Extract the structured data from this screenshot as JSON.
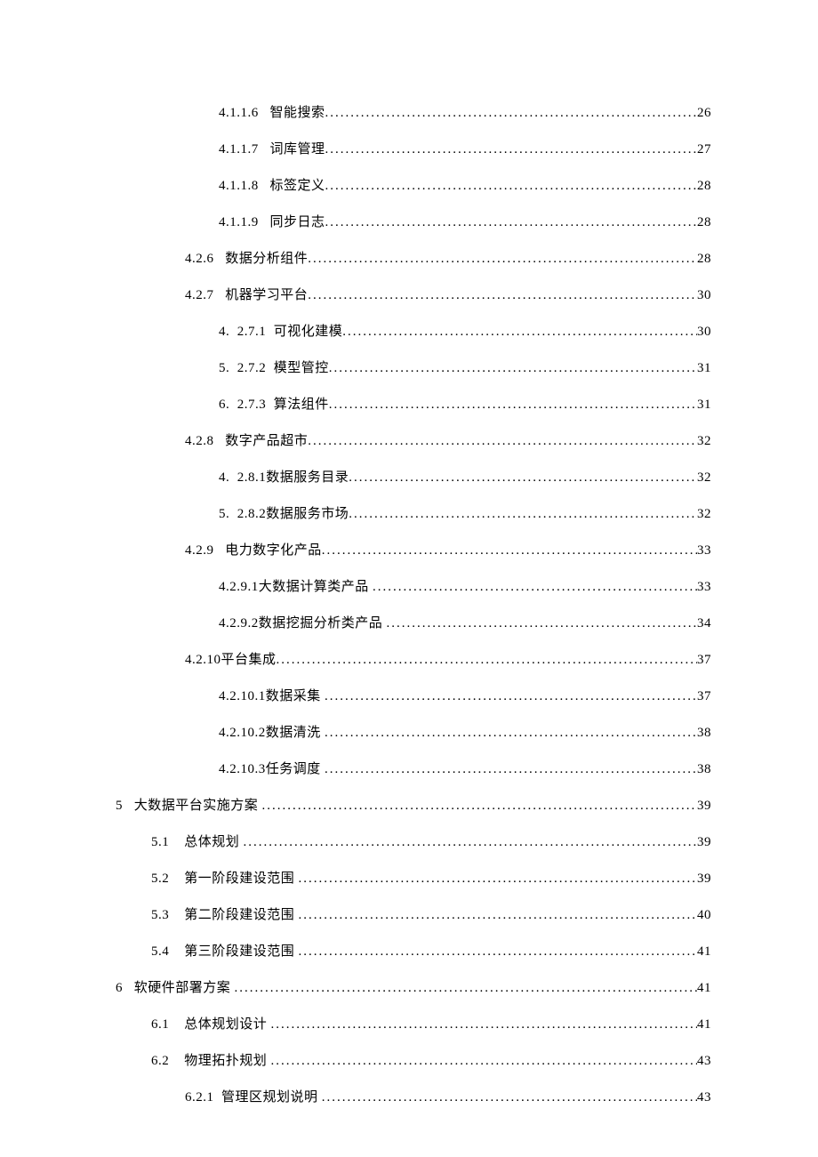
{
  "dotfill": "................................................................................................................................",
  "toc": [
    {
      "indent": "indent-l4",
      "num": "4.1.1.6",
      "gap": "   ",
      "title": "智能搜索",
      "page": "26"
    },
    {
      "indent": "indent-l4",
      "num": "4.1.1.7",
      "gap": "   ",
      "title": "词库管理",
      "page": "27"
    },
    {
      "indent": "indent-l4",
      "num": "4.1.1.8",
      "gap": "   ",
      "title": "标签定义",
      "page": "28"
    },
    {
      "indent": "indent-l4",
      "num": "4.1.1.9",
      "gap": "   ",
      "title": "同步日志",
      "page": "28"
    },
    {
      "indent": "indent-l3",
      "num": "4.2.6",
      "gap": "   ",
      "title": "数据分析组件",
      "page": "28"
    },
    {
      "indent": "indent-l3",
      "num": "4.2.7",
      "gap": "   ",
      "title": "机器学习平台",
      "page": "30"
    },
    {
      "indent": "indent-l4",
      "num": "4.",
      "gap": "  ",
      "title": "2.7.1  可视化建模",
      "page": "30"
    },
    {
      "indent": "indent-l4",
      "num": "5.",
      "gap": "  ",
      "title": "2.7.2  模型管控",
      "page": "31"
    },
    {
      "indent": "indent-l4",
      "num": "6.",
      "gap": "  ",
      "title": "2.7.3  算法组件",
      "page": "31"
    },
    {
      "indent": "indent-l3",
      "num": "4.2.8",
      "gap": "   ",
      "title": "数字产品超市",
      "page": "32"
    },
    {
      "indent": "indent-l4",
      "num": "4.",
      "gap": "  ",
      "title": "2.8.1数据服务目录",
      "page": "32"
    },
    {
      "indent": "indent-l4",
      "num": "5.",
      "gap": "  ",
      "title": "2.8.2数据服务市场",
      "page": "32"
    },
    {
      "indent": "indent-l3",
      "num": "4.2.9",
      "gap": "   ",
      "title": "电力数字化产品",
      "page": "33"
    },
    {
      "indent": "indent-l4",
      "num": "4.2.9.1",
      "gap": "",
      "title": "大数据计算类产品 ",
      "page": "33"
    },
    {
      "indent": "indent-l4",
      "num": "4.2.9.2",
      "gap": "",
      "title": "数据挖掘分析类产品 ",
      "page": "34"
    },
    {
      "indent": "indent-l3",
      "num": "4.2.10",
      "gap": "",
      "title": "平台集成",
      "page": "37"
    },
    {
      "indent": "indent-l4",
      "num": "4.2.10.1",
      "gap": "",
      "title": "数据采集 ",
      "page": "37"
    },
    {
      "indent": "indent-l4",
      "num": "4.2.10.2",
      "gap": "",
      "title": "数据清洗 ",
      "page": "38"
    },
    {
      "indent": "indent-l4",
      "num": "4.2.10.3",
      "gap": "",
      "title": "任务调度 ",
      "page": "38"
    },
    {
      "indent": "indent-l1",
      "num": "5",
      "gap": "   ",
      "title": "大数据平台实施方案 ",
      "page": "39"
    },
    {
      "indent": "indent-l2",
      "num": "5.1",
      "gap": "    ",
      "title": "总体规划 ",
      "page": "39"
    },
    {
      "indent": "indent-l2",
      "num": "5.2",
      "gap": "    ",
      "title": "第一阶段建设范围 ",
      "page": "39"
    },
    {
      "indent": "indent-l2",
      "num": "5.3",
      "gap": "    ",
      "title": "第二阶段建设范围 ",
      "page": "40"
    },
    {
      "indent": "indent-l2",
      "num": "5.4",
      "gap": "    ",
      "title": "第三阶段建设范围 ",
      "page": "41"
    },
    {
      "indent": "indent-l1",
      "num": "6",
      "gap": "   ",
      "title": "软硬件部署方案 ",
      "page": "41"
    },
    {
      "indent": "indent-l2",
      "num": "6.1",
      "gap": "    ",
      "title": "总体规划设计 ",
      "page": "41"
    },
    {
      "indent": "indent-l2",
      "num": "6.2",
      "gap": "    ",
      "title": "物理拓扑规划 ",
      "page": "43"
    },
    {
      "indent": "indent-l3",
      "num": "6.2.1",
      "gap": "  ",
      "title": "管理区规划说明 ",
      "page": "43"
    }
  ]
}
